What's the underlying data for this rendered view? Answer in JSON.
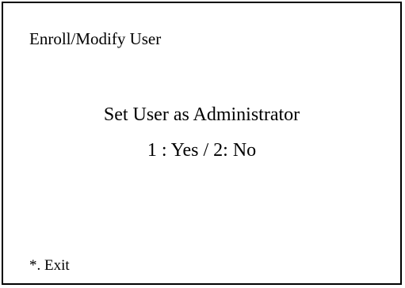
{
  "screen": {
    "title": "Enroll/Modify User",
    "prompt_line_1": "Set User as Administrator",
    "prompt_line_2": "1 : Yes / 2: No",
    "exit_label": "*. Exit"
  }
}
